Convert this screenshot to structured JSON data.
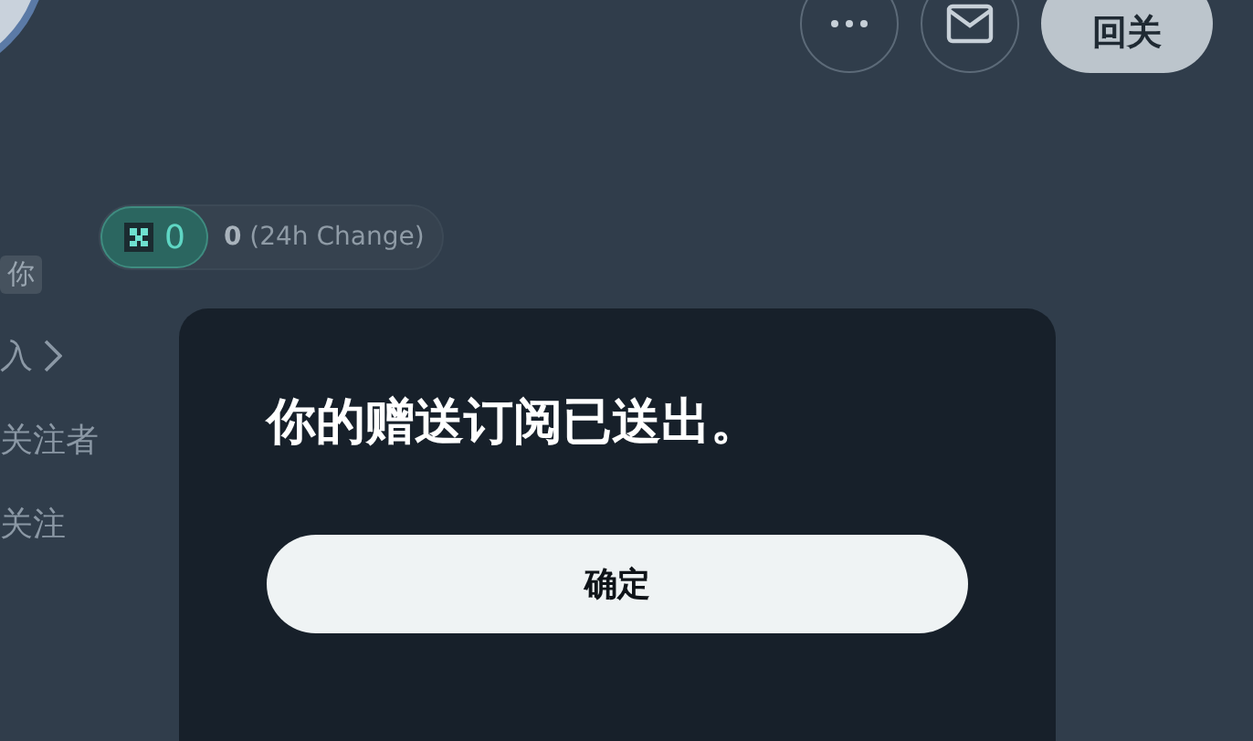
{
  "header": {
    "buttons": [
      {
        "kind": "more"
      },
      {
        "kind": "mail"
      }
    ],
    "action_button": "回关"
  },
  "token_pill": {
    "amount": "0",
    "change": "0",
    "change_label": "(24h Change)"
  },
  "sidebar_fragments": [
    {
      "kind": "badge",
      "text": "你"
    },
    {
      "kind": "link",
      "text": "入"
    },
    {
      "kind": "text",
      "text": "关注者"
    },
    {
      "kind": "text",
      "text": "关注"
    }
  ],
  "dialog": {
    "message": "你的赠送订阅已送出。",
    "button": "确定"
  }
}
